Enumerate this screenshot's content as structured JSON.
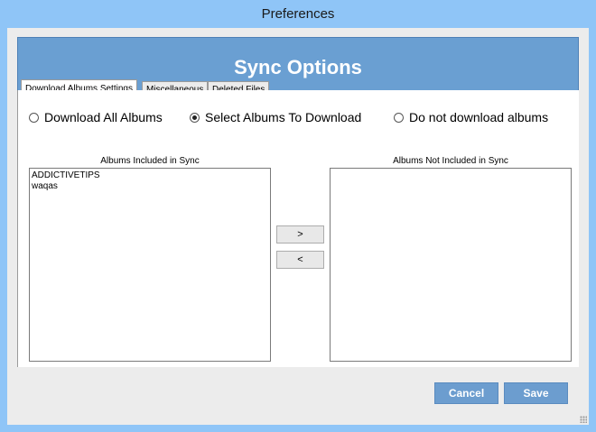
{
  "window": {
    "title": "Preferences"
  },
  "header": {
    "title": "Sync Options"
  },
  "tabs": [
    {
      "label": "Download Albums Settings",
      "active": true
    },
    {
      "label": "Miscellaneous",
      "active": false
    },
    {
      "label": "Deleted Files",
      "active": false
    }
  ],
  "download_mode": {
    "options": [
      {
        "label": "Download All Albums",
        "checked": false
      },
      {
        "label": "Select Albums To Download",
        "checked": true
      },
      {
        "label": "Do not download albums",
        "checked": false
      }
    ]
  },
  "included_list": {
    "caption": "Albums Included in Sync",
    "items": [
      "ADDICTIVETIPS",
      "waqas"
    ]
  },
  "excluded_list": {
    "caption": "Albums Not Included in Sync",
    "items": []
  },
  "move_buttons": {
    "right_label": ">",
    "left_label": "<"
  },
  "footer": {
    "cancel_label": "Cancel",
    "save_label": "Save"
  },
  "colors": {
    "titlebar_bg": "#8fc5f7",
    "header_bg": "#6a9fd2",
    "button_bg": "#6c9dcf"
  }
}
